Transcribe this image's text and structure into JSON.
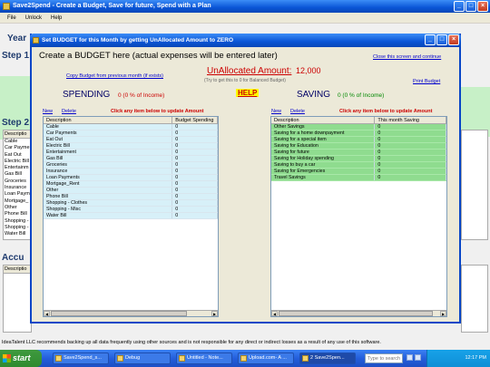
{
  "app": {
    "title": "Save2Spend - Create a Budget, Save for future, Spend with a Plan",
    "menu": [
      "File",
      "Unlock",
      "Help"
    ],
    "bg_labels": {
      "year": "Year",
      "step1": "Step 1:",
      "step2": "Step 2",
      "accu": "Accu"
    },
    "bg_table_header": "Descriptio",
    "bg_table_rows": [
      "Cable",
      "Car Payme",
      "Eat Out",
      "Electric Bill",
      "Entertainm",
      "Gas Bill",
      "Groceries",
      "Insurance",
      "Loan Paym",
      "Mortgage_",
      "Other",
      "Phone Bill",
      "Shopping -",
      "Shopping -",
      "Water Bill"
    ],
    "bg_accu_header": "Descriptio",
    "footer": "IdeaTalent LLC recommends backing up all data frequently using other sources and is not responsible for any direct or indirect losses as a result of any use of this software."
  },
  "dialog": {
    "title": "Set BUDGET for this Month by getting UnAllocated Amount to ZERO",
    "heading": "Create a BUDGET here (actual expenses will be entered later)",
    "close_link": "Close this screen and continue",
    "copy_link": "Copy Budget from previous month (if exists)",
    "unallocated_label": "UnAllocated Amount:",
    "unallocated_value": "12,000",
    "unallocated_hint": "(Try to get this to 0 for Balanced Budget)",
    "print_link": "Print Budget",
    "help": "HELP",
    "spending": {
      "title": "SPENDING",
      "pct": "0 (0 % of Income)",
      "new": "New",
      "delete": "Delete",
      "note": "Click any item below to update Amount",
      "col1": "Description",
      "col2": "Budget Spending",
      "rows": [
        [
          "Cable",
          "0"
        ],
        [
          "Car Payments",
          "0"
        ],
        [
          "Eat Out",
          "0"
        ],
        [
          "Electric Bill",
          "0"
        ],
        [
          "Entertainment",
          "0"
        ],
        [
          "Gas Bill",
          "0"
        ],
        [
          "Groceries",
          "0"
        ],
        [
          "Insurance",
          "0"
        ],
        [
          "Loan Payments",
          "0"
        ],
        [
          "Mortgage_Rent",
          "0"
        ],
        [
          "Other",
          "0"
        ],
        [
          "Phone Bill",
          "0"
        ],
        [
          "Shopping - Clothes",
          "0"
        ],
        [
          "Shopping - Misc",
          "0"
        ],
        [
          "Water Bill",
          "0"
        ]
      ]
    },
    "saving": {
      "title": "SAVING",
      "pct": "0 (0 % of Income)",
      "new": "New",
      "delete": "Delete",
      "note": "Click any item below to update Amount",
      "col1": "Description",
      "col2": "This month Saving",
      "rows": [
        [
          "Other Savings",
          "0"
        ],
        [
          "Saving for a home downpayment",
          "0"
        ],
        [
          "Saving for a special item",
          "0"
        ],
        [
          "Saving for Education",
          "0"
        ],
        [
          "Saving for future",
          "0"
        ],
        [
          "Saving for Holiday spending",
          "0"
        ],
        [
          "Saving to buy a car",
          "0"
        ],
        [
          "Saving for Emergencies",
          "0"
        ],
        [
          "Travel Savings",
          "0"
        ]
      ]
    }
  },
  "taskbar": {
    "start": "start",
    "tasks": [
      "Save2Spend_s...",
      "Debug",
      "Untitled - Note...",
      "Upload.com- A ...",
      "2 Save2Spen..."
    ],
    "search_placeholder": "Type to search",
    "clock": "12:17 PM"
  }
}
